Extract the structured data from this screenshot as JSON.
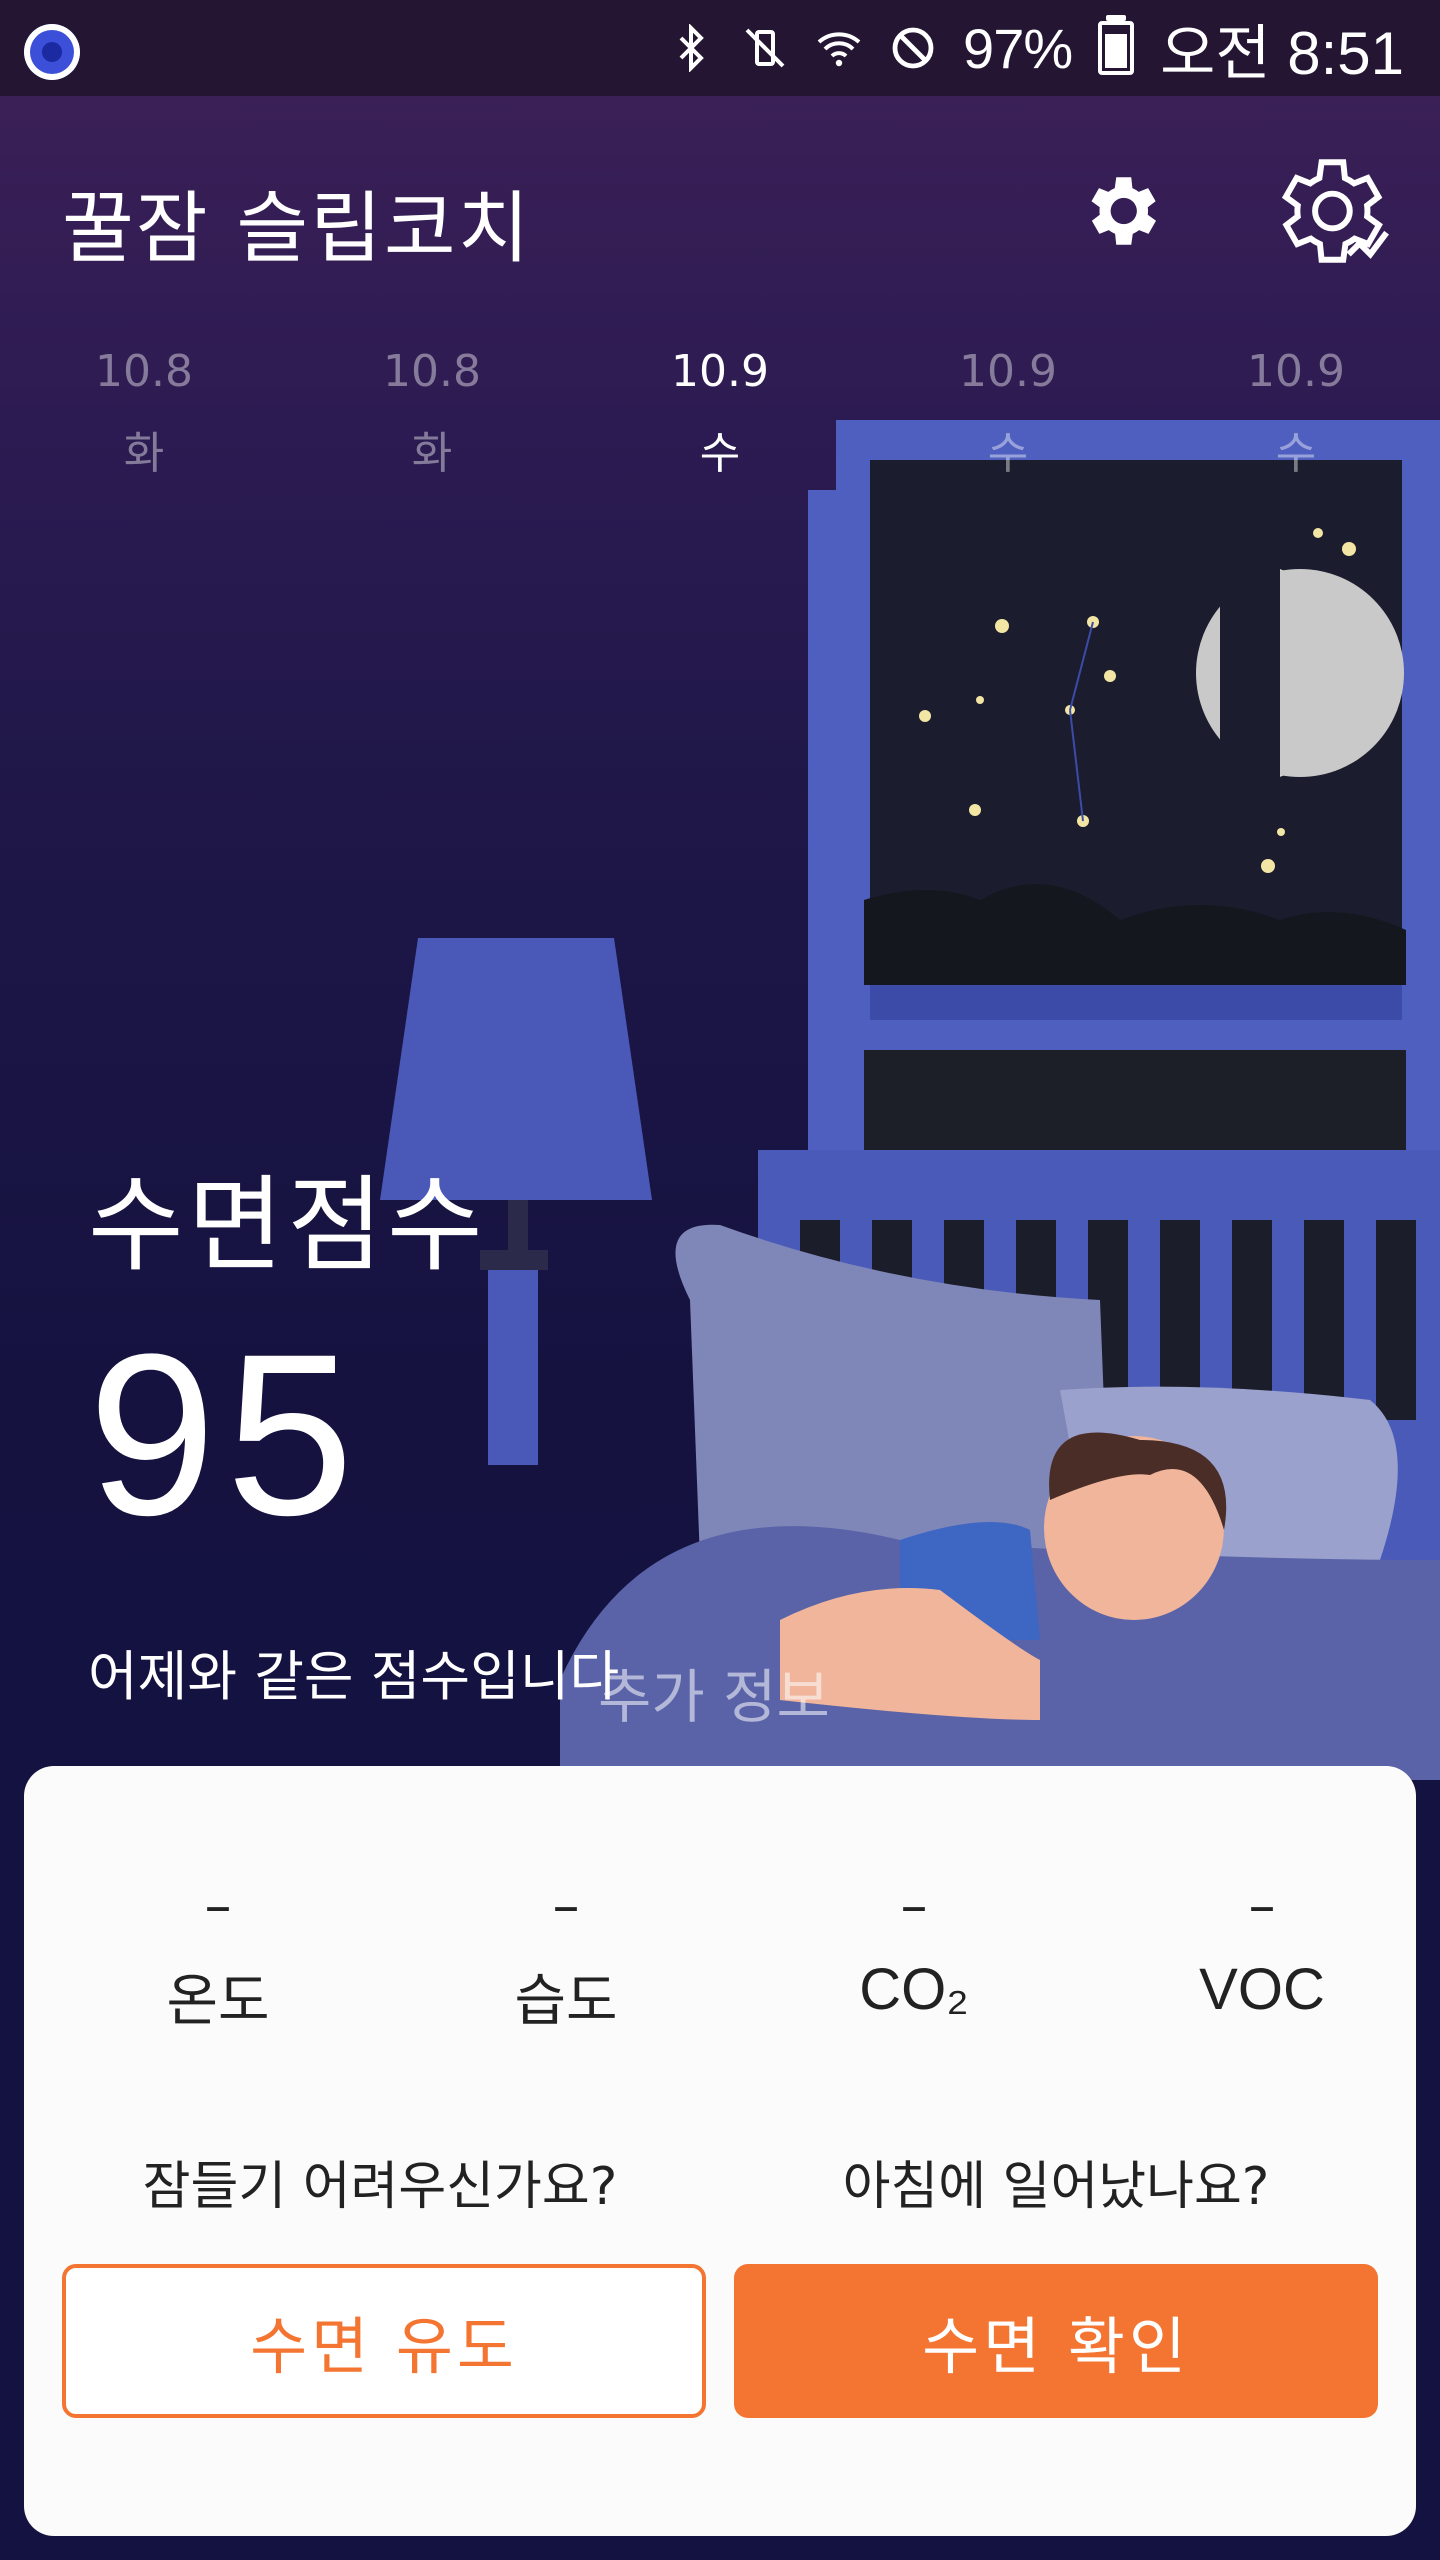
{
  "status_bar": {
    "battery_percent": "97%",
    "time": "오전 8:51",
    "icons": [
      "app-notification-icon",
      "bluetooth-icon",
      "vibrate-muted-icon",
      "wifi-icon",
      "do-not-disturb-icon",
      "battery-charging-icon"
    ]
  },
  "header": {
    "title": "꿀잠 슬립코치",
    "settings_icon": "gear-icon",
    "device_settings_icon": "gear-outline-icon"
  },
  "dates": [
    {
      "date": "10.8",
      "weekday": "화",
      "active": false
    },
    {
      "date": "10.8",
      "weekday": "화",
      "active": false
    },
    {
      "date": "10.9",
      "weekday": "수",
      "active": true
    },
    {
      "date": "10.9",
      "weekday": "수",
      "active": false
    },
    {
      "date": "10.9",
      "weekday": "수",
      "active": false
    }
  ],
  "score": {
    "label": "수면점수",
    "value": "95",
    "comparison": "어제와 같은 점수입니다",
    "more_info": "추가 정보"
  },
  "sensors": [
    {
      "value": "–",
      "label": "온도"
    },
    {
      "value": "–",
      "label": "습도"
    },
    {
      "value": "–",
      "label": "CO₂"
    },
    {
      "value": "–",
      "label": "VOC"
    }
  ],
  "actions": {
    "induce_question": "잠들기 어려우신가요?",
    "induce_button": "수면 유도",
    "check_question": "아침에 일어났나요?",
    "check_button": "수면 확인"
  },
  "colors": {
    "accent": "#f47532",
    "background_top": "#3e2158",
    "background_bottom": "#141240"
  }
}
